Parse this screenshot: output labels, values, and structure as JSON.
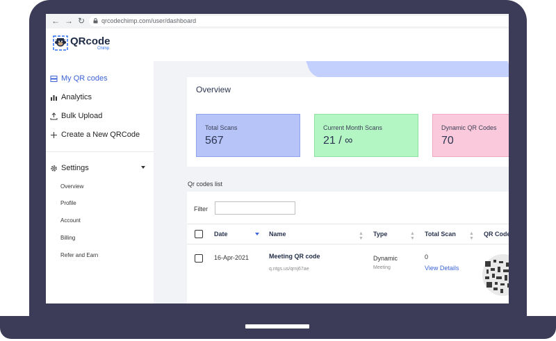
{
  "browser": {
    "back_icon": "←",
    "forward_icon": "→",
    "reload_icon": "↻",
    "url": "qrcodechimp.com/user/dashboard"
  },
  "header": {
    "logo_text": "QRcode",
    "logo_sub": "Chimp"
  },
  "sidebar": {
    "items": [
      {
        "label": "My QR codes",
        "icon": "stack-icon",
        "active": true
      },
      {
        "label": "Analytics",
        "icon": "bar-chart-icon"
      },
      {
        "label": "Bulk Upload",
        "icon": "upload-icon"
      },
      {
        "label": "Create a New QRCode",
        "icon": "plus-icon"
      }
    ],
    "settings": {
      "label": "Settings",
      "icon": "gear-icon",
      "subitems": [
        "Overview",
        "Profile",
        "Account",
        "Billing",
        "Refer and Earn"
      ]
    }
  },
  "overview": {
    "title": "Overview",
    "stats": [
      {
        "label": "Total Scans",
        "value": "567",
        "color": "#b7c4f8"
      },
      {
        "label": "Current Month Scans",
        "value": "21 / ∞",
        "color": "#b3f5c3"
      },
      {
        "label": "Dynamic QR Codes",
        "value": "70",
        "color": "#fac9db"
      }
    ]
  },
  "qr_list": {
    "title": "Qr codes list",
    "filter_label": "Filter",
    "filter_value": "",
    "columns": [
      "Date",
      "Name",
      "Type",
      "Total Scan",
      "QR Code"
    ],
    "rows": [
      {
        "date": "16-Apr-2021",
        "name": "Meeting QR code",
        "short_url": "q.ntgs.us/qrnj67ae",
        "type": "Dynamic",
        "subtype": "Meeting",
        "total_scan": "0",
        "view_details": "View Details"
      }
    ]
  },
  "colors": {
    "frame": "#3d3c58",
    "accent": "#3c64d6",
    "band": "#c3cffd"
  }
}
